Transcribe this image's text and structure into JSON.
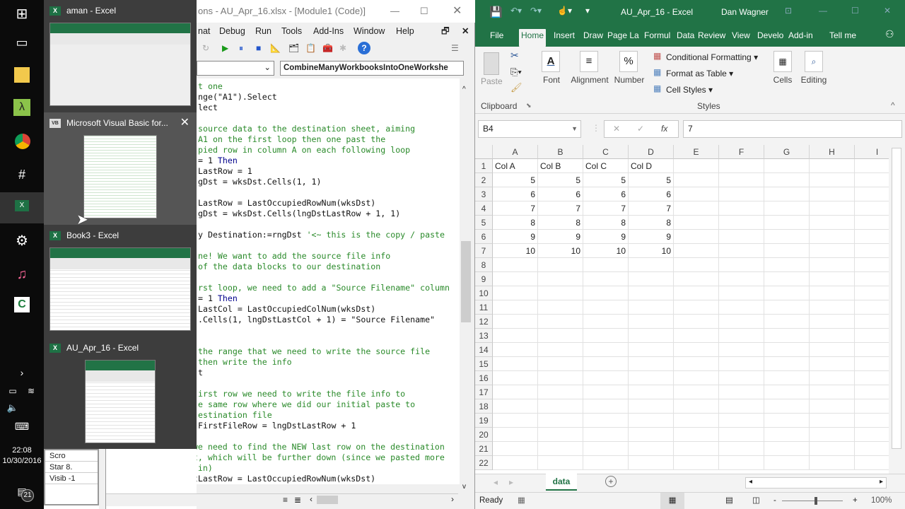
{
  "taskbar": {
    "time": "22:08",
    "date": "10/30/2016",
    "notification_count": "21",
    "icons": [
      "windows-start-icon",
      "task-view-icon",
      "file-explorer-icon",
      "lambda-app-icon",
      "chrome-icon",
      "slack-icon",
      "excel-icon",
      "settings-icon",
      "itunes-icon",
      "camtasia-icon"
    ]
  },
  "switcher": {
    "items": [
      {
        "title": "aman - Excel",
        "app_icon": "X"
      },
      {
        "title": "Microsoft Visual Basic for...",
        "app_icon": "VB"
      },
      {
        "title": "Book3 - Excel",
        "app_icon": "X"
      },
      {
        "title": "AU_Apr_16 - Excel",
        "app_icon": "X"
      }
    ]
  },
  "vbe": {
    "title": "ons - AU_Apr_16.xlsx - [Module1 (Code)]",
    "menu": [
      "nat",
      "Debug",
      "Run",
      "Tools",
      "Add-Ins",
      "Window",
      "Help"
    ],
    "procedure_combo": "CombineManyWorkbooksIntoOneWorkshe",
    "code_lines": [
      [
        [
          "t one",
          "comment"
        ]
      ],
      [
        [
          "nge(\"A1\").Select",
          "code"
        ]
      ],
      [
        [
          "lect",
          "code"
        ]
      ],
      [],
      [
        [
          "source data to the destination sheet, aiming",
          "comment"
        ]
      ],
      [
        [
          "A1 on the first loop then one past the",
          "comment"
        ]
      ],
      [
        [
          "pied row in column A on each following loop",
          "comment"
        ]
      ],
      [
        [
          "= 1 ",
          "code"
        ],
        [
          "Then",
          "kw"
        ]
      ],
      [
        [
          "LastRow = 1",
          "code"
        ]
      ],
      [
        [
          "gDst = wksDst.Cells(1, 1)",
          "code"
        ]
      ],
      [],
      [
        [
          "LastRow = LastOccupiedRowNum(wksDst)",
          "code"
        ]
      ],
      [
        [
          "gDst = wksDst.Cells(lngDstLastRow + 1, 1)",
          "code"
        ]
      ],
      [],
      [
        [
          "y Destination:=rngDst ",
          "code"
        ],
        [
          "'<~ this is the copy / paste",
          "comment"
        ]
      ],
      [],
      [
        [
          "ne! We want to add the source file info",
          "comment"
        ]
      ],
      [
        [
          "of the data blocks to our destination",
          "comment"
        ]
      ],
      [],
      [
        [
          "rst loop, we need to add a \"Source Filename\" column",
          "comment"
        ]
      ],
      [
        [
          "= 1 ",
          "code"
        ],
        [
          "Then",
          "kw"
        ]
      ],
      [
        [
          "LastCol = LastOccupiedColNum(wksDst)",
          "code"
        ]
      ],
      [
        [
          ".Cells(1, lngDstLastCol + 1) = \"Source Filename\"",
          "code"
        ]
      ],
      [],
      [],
      [
        [
          "the range that we need to write the source file",
          "comment"
        ]
      ],
      [
        [
          "then write the info",
          "comment"
        ]
      ],
      [
        [
          "t",
          "code"
        ]
      ],
      [],
      [
        [
          "irst row we need to write the file info to",
          "comment"
        ]
      ],
      [
        [
          "e same row where we did our initial paste to",
          "comment"
        ]
      ],
      [
        [
          "estination file",
          "comment"
        ]
      ],
      [
        [
          "FirstFileRow = lngDstLastRow + 1",
          "code"
        ]
      ],
      [],
      [
        [
          "'Now we need to find the NEW last row on the destination",
          "comment"
        ]
      ],
      [
        [
          "'sheet, which will be further down (since we pasted more",
          "comment"
        ]
      ],
      [
        [
          "'data in)",
          "comment"
        ]
      ],
      [
        [
          "lngDstLastRow = LastOccupiedRowNum(wksDst)",
          "code"
        ]
      ]
    ],
    "properties": [
      [
        "Scro",
        ""
      ],
      [
        "Star",
        "8."
      ],
      [
        "Visib",
        "-1"
      ]
    ]
  },
  "excel": {
    "title": "AU_Apr_16  -  Excel",
    "user": "Dan Wagner",
    "tabs": [
      "File",
      "Home",
      "Insert",
      "Draw",
      "Page La",
      "Formul",
      "Data",
      "Review",
      "View",
      "Develo",
      "Add-in",
      "Tell me"
    ],
    "active_tab": "Home",
    "ribbon": {
      "paste": "Paste",
      "clipboard": "Clipboard",
      "font": "Font",
      "alignment": "Alignment",
      "number": "Number",
      "conditional_formatting": "Conditional Formatting",
      "format_as_table": "Format as Table",
      "cell_styles": "Cell Styles",
      "styles": "Styles",
      "cells": "Cells",
      "editing": "Editing"
    },
    "name_box": "B4",
    "formula": "7",
    "columns": [
      "A",
      "B",
      "C",
      "D",
      "E",
      "F",
      "G",
      "H",
      "I"
    ],
    "rows": [
      "1",
      "2",
      "3",
      "4",
      "5",
      "6",
      "7",
      "8",
      "9",
      "10",
      "11",
      "12",
      "13",
      "14",
      "15",
      "16",
      "17",
      "18",
      "19",
      "20",
      "21",
      "22"
    ],
    "headers": [
      "Col A",
      "Col B",
      "Col C",
      "Col D"
    ],
    "data": [
      [
        5,
        5,
        5,
        5
      ],
      [
        6,
        6,
        6,
        6
      ],
      [
        7,
        7,
        7,
        7
      ],
      [
        8,
        8,
        8,
        8
      ],
      [
        9,
        9,
        9,
        9
      ],
      [
        10,
        10,
        10,
        10
      ]
    ],
    "sheet_tab": "data",
    "status": "Ready",
    "zoom": "100%",
    "accent": "#217346"
  }
}
